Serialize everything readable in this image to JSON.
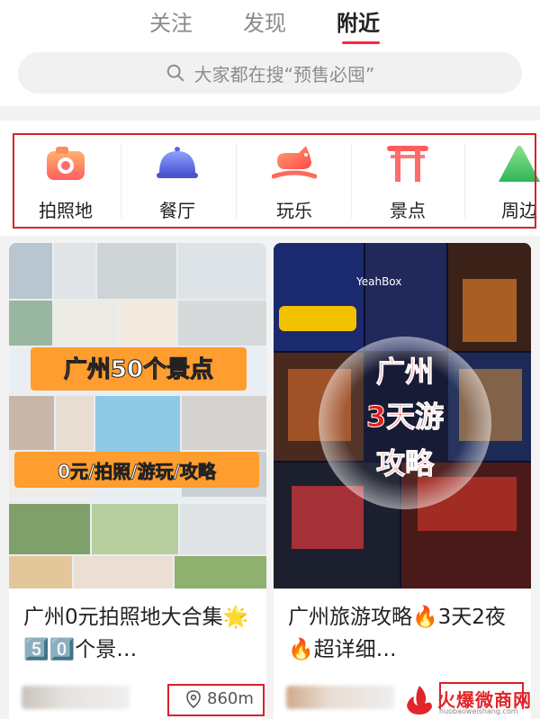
{
  "tabs": [
    {
      "label": "关注"
    },
    {
      "label": "发现"
    },
    {
      "label": "附近",
      "active": true
    }
  ],
  "search": {
    "placeholder": "大家都在搜“预售必囤”"
  },
  "categories": [
    {
      "label": "拍照地",
      "icon": "camera-icon"
    },
    {
      "label": "餐厅",
      "icon": "food-cloche-icon"
    },
    {
      "label": "玩乐",
      "icon": "rocking-horse-icon"
    },
    {
      "label": "景点",
      "icon": "torii-gate-icon"
    },
    {
      "label": "周边",
      "icon": "mountain-icon"
    }
  ],
  "cards": [
    {
      "cover_title": "广州50个景点",
      "cover_subtitle": "0元/拍照/游玩/攻略",
      "title": "广州0元拍照地大合集🌟5️⃣0️⃣个景…",
      "distance": "860m"
    },
    {
      "cover_title_1": "广州",
      "cover_title_2": "3天游",
      "cover_title_3": "攻略",
      "cover_sign": "YeahBox",
      "title": "广州旅游攻略🔥3天2夜🔥超详细…"
    }
  ],
  "watermark": {
    "text": "火爆微商网",
    "sub": "huobaoweishang.com"
  },
  "colors": {
    "accent": "#ff2442",
    "highlight_border": "#d9222a"
  }
}
